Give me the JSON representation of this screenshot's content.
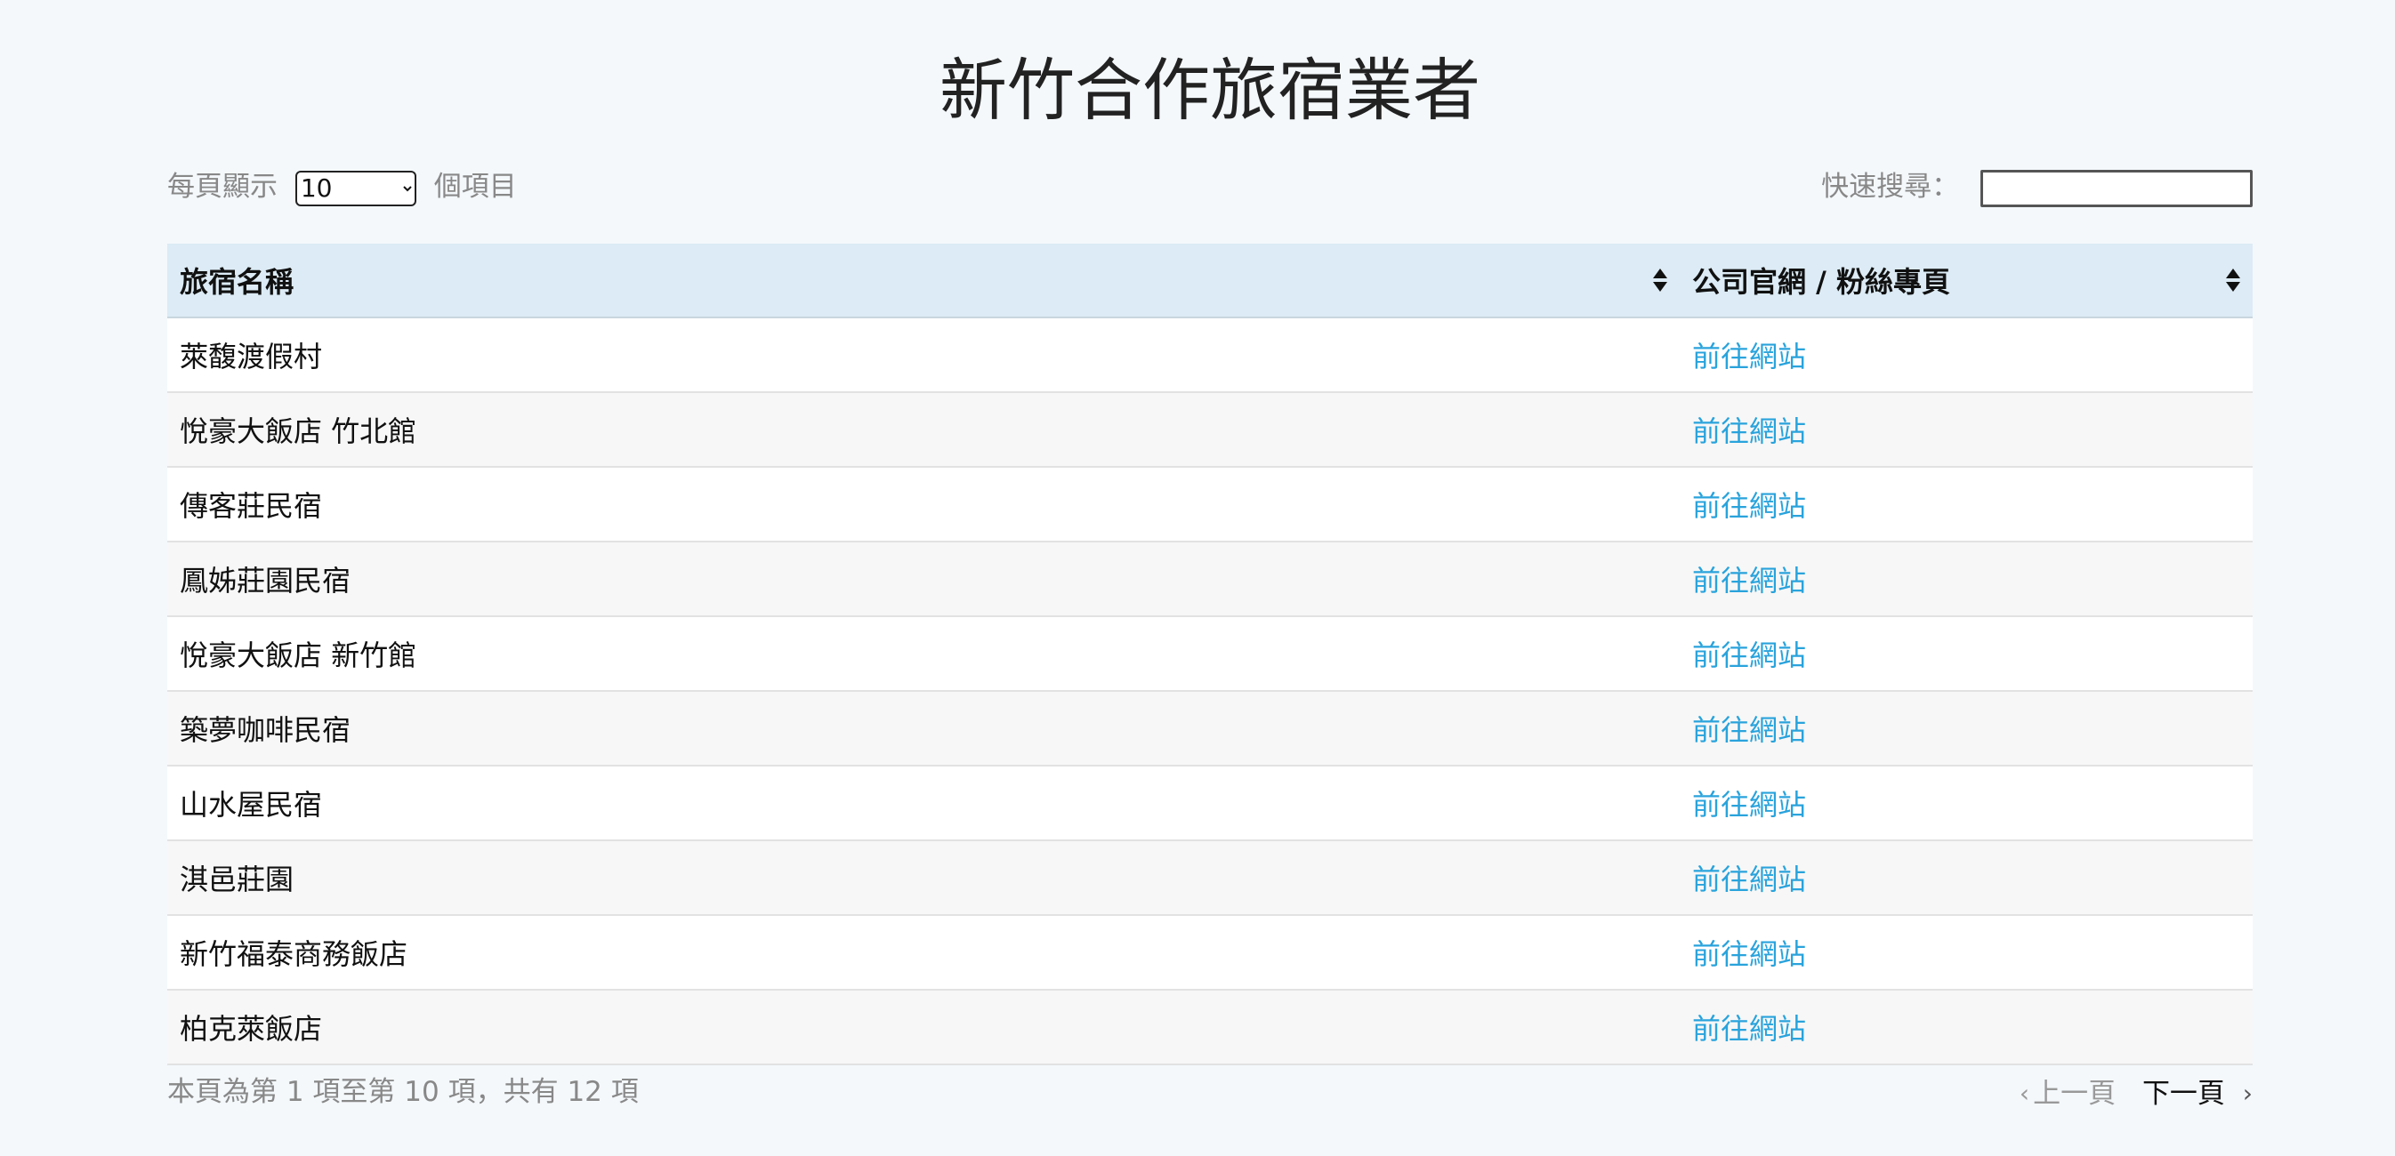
{
  "page_title": "新竹合作旅宿業者",
  "length_control": {
    "prefix": "每頁顯示",
    "selected": "10",
    "suffix": "個項目"
  },
  "search": {
    "label": "快速搜尋："
  },
  "table": {
    "columns": [
      "旅宿名稱",
      "公司官網 / 粉絲專頁"
    ],
    "rows": [
      {
        "name": "萊馥渡假村",
        "link": "前往網站"
      },
      {
        "name": "悅豪大飯店 竹北館",
        "link": "前往網站"
      },
      {
        "name": "傳客莊民宿",
        "link": "前往網站"
      },
      {
        "name": "鳳姊莊園民宿",
        "link": "前往網站"
      },
      {
        "name": "悅豪大飯店 新竹館",
        "link": "前往網站"
      },
      {
        "name": "築夢咖啡民宿",
        "link": "前往網站"
      },
      {
        "name": "山水屋民宿",
        "link": "前往網站"
      },
      {
        "name": "淇邑莊園",
        "link": "前往網站"
      },
      {
        "name": "新竹福泰商務飯店",
        "link": "前往網站"
      },
      {
        "name": "柏克萊飯店",
        "link": "前往網站"
      }
    ]
  },
  "footer": {
    "info": "本頁為第 1 項至第 10 項，共有 12 項",
    "prev_label": "上一頁",
    "next_label": "下一頁"
  },
  "colors": {
    "background": "#f4f8fb",
    "header_bg": "#dcebf5",
    "link": "#29a3dc"
  }
}
